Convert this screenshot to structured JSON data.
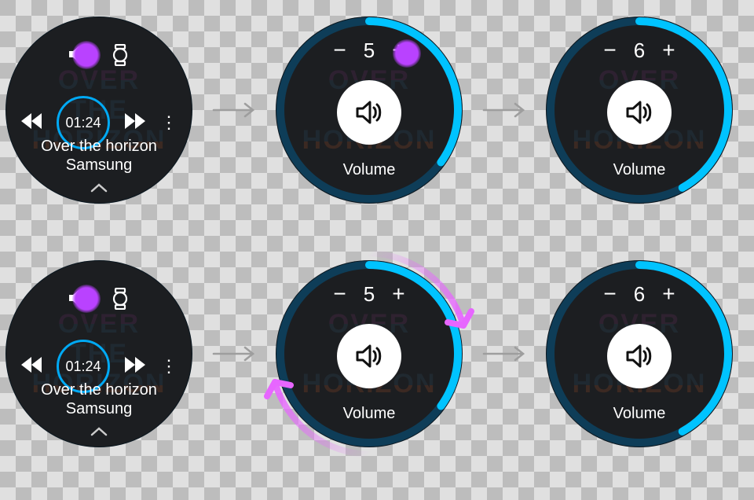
{
  "player": {
    "elapsed": "01:24",
    "title": "Over the horizon",
    "artist": "Samsung"
  },
  "volume": {
    "label": "Volume",
    "before": "5",
    "after": "6",
    "minus": "−",
    "plus": "+"
  },
  "progress": {
    "before_deg": 126,
    "after_deg": 151
  },
  "colors": {
    "accent": "#00a9f4",
    "tap": "#b942ff"
  }
}
